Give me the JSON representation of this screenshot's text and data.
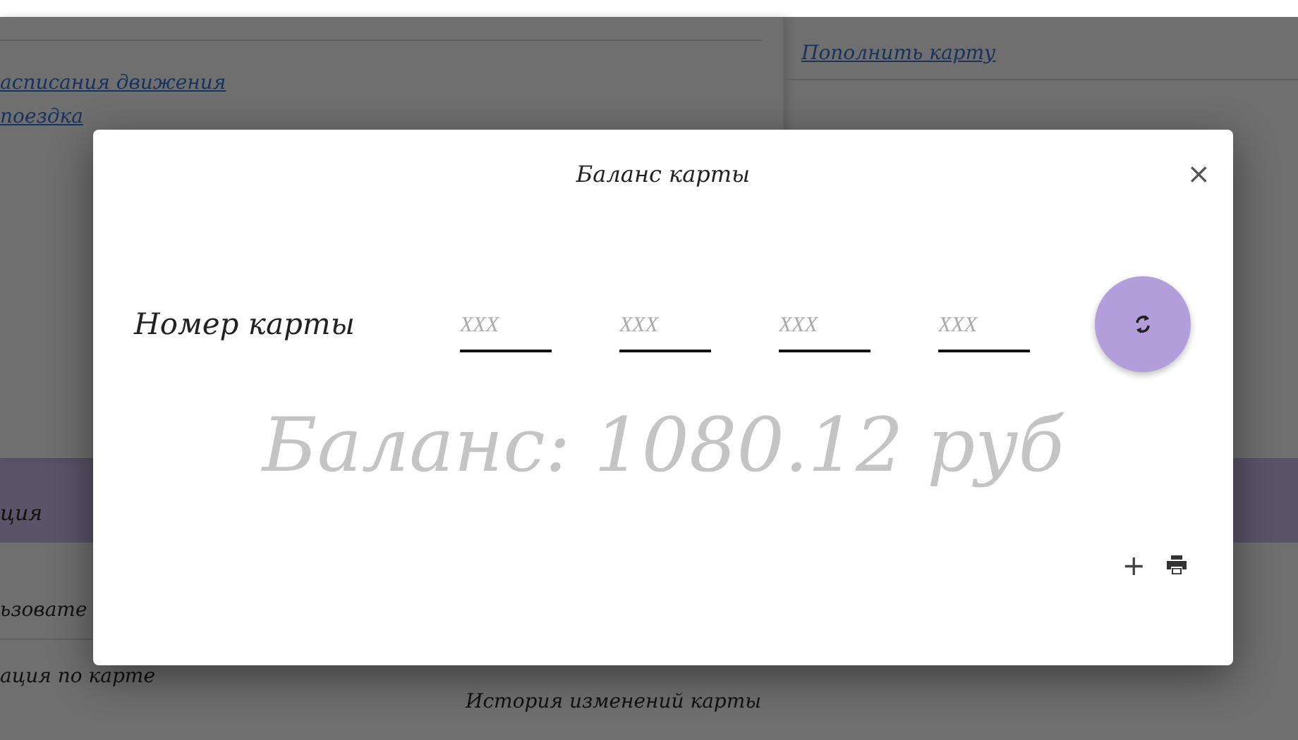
{
  "page": {
    "left_links": [
      "асписания движения",
      "поездка"
    ],
    "right_links": [
      "Пополнить карту"
    ],
    "band_title": "ция",
    "left_items": [
      "ьзовате",
      "ация по карте"
    ],
    "right_items": [
      "История изменений карты"
    ]
  },
  "dialog": {
    "title": "Баланс карты",
    "close": "×",
    "card_label": "Номер карты",
    "card_fields": [
      {
        "placeholder": "XXX"
      },
      {
        "placeholder": "XXX"
      },
      {
        "placeholder": "XXX"
      },
      {
        "placeholder": "XXX"
      }
    ],
    "balance": "Баланс: 1080.12 руб",
    "add": "+"
  }
}
